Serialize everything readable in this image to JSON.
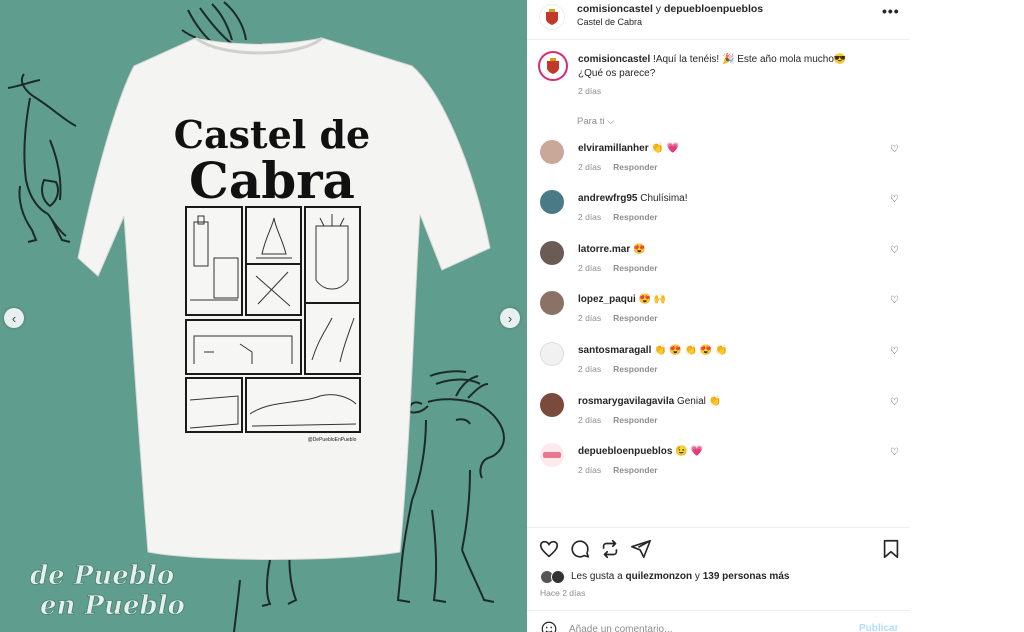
{
  "post": {
    "author": "comisioncastel",
    "connector": "y",
    "collaborator": "depuebloenpueblos",
    "location": "Castel de Cabra",
    "more_icon": "more-horizontal-icon"
  },
  "media": {
    "shirt_title_line1": "Castel de",
    "shirt_title_line2": "Cabra",
    "shirt_credit": "@DePuebloEnPueblo",
    "watermark_line1": "de Pueblo",
    "watermark_line2": "en Pueblo",
    "prev_icon": "‹",
    "next_icon": "›",
    "background_color": "#5f9d8e"
  },
  "caption": {
    "author": "comisioncastel",
    "text_part1": " !Aquí la tenéis! 🎉 Este año mola mucho😎",
    "text_part2": "¿Qué os parece?",
    "time": "2 días"
  },
  "comments_filter": "Para ti",
  "comments": [
    {
      "user": "elviramillanher",
      "text": "👏 💗",
      "time": "2 días",
      "reply": "Responder",
      "avatar_color": "#c9a89a"
    },
    {
      "user": "andrewfrg95",
      "text": "Chulísima!",
      "time": "2 días",
      "reply": "Responder",
      "avatar_color": "#4a7a86"
    },
    {
      "user": "latorre.mar",
      "text": "😍",
      "time": "2 días",
      "reply": "Responder",
      "avatar_color": "#6b5b55"
    },
    {
      "user": "lopez_paqui",
      "text": "😍 🙌",
      "time": "2 días",
      "reply": "Responder",
      "avatar_color": "#8a7266"
    },
    {
      "user": "santosmaragall",
      "text": "👏 😍 👏 😍 👏",
      "time": "2 días",
      "reply": "Responder",
      "avatar_color": "#f1f1f1"
    },
    {
      "user": "rosmarygavilagavila",
      "text": "Genial 👏",
      "time": "2 días",
      "reply": "Responder",
      "avatar_color": "#7a4a3c"
    },
    {
      "user": "depuebloenpueblos",
      "text": "😉 💗",
      "time": "2 días",
      "reply": "Responder",
      "avatar_color": "#fde8ec"
    }
  ],
  "actions": {
    "like_icon": "heart-icon",
    "comment_icon": "comment-icon",
    "share_icon": "repost-icon",
    "send_icon": "send-icon",
    "save_icon": "bookmark-icon"
  },
  "likes": {
    "prefix": "Les gusta a ",
    "user": "quilezmonzon",
    "middle": " y ",
    "others": "139 personas más"
  },
  "ago": "Hace 2 días",
  "add_comment": {
    "placeholder": "Añade un comentario...",
    "publish": "Publicar"
  }
}
